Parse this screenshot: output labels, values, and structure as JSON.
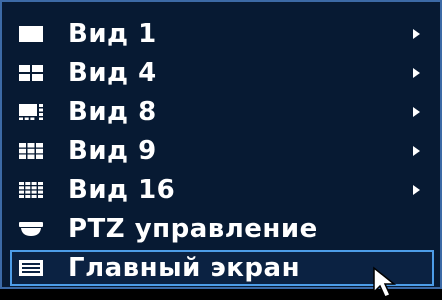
{
  "menu": {
    "items": [
      {
        "label": "Вид 1",
        "icon": "single-view-icon",
        "has_submenu": true
      },
      {
        "label": "Вид 4",
        "icon": "quad-view-icon",
        "has_submenu": true
      },
      {
        "label": "Вид 8",
        "icon": "eight-view-icon",
        "has_submenu": true
      },
      {
        "label": "Вид 9",
        "icon": "nine-grid-view-icon",
        "has_submenu": true
      },
      {
        "label": "Вид 16",
        "icon": "sixteen-grid-view-icon",
        "has_submenu": true
      },
      {
        "label": "PTZ управление",
        "icon": "ptz-camera-icon",
        "has_submenu": false
      },
      {
        "label": "Главный экран",
        "icon": "main-screen-icon",
        "has_submenu": false,
        "selected": true
      }
    ]
  },
  "colors": {
    "background": "#071a33",
    "border": "#3c6aa6",
    "selected_border": "#4d9de8",
    "text": "#ffffff"
  }
}
